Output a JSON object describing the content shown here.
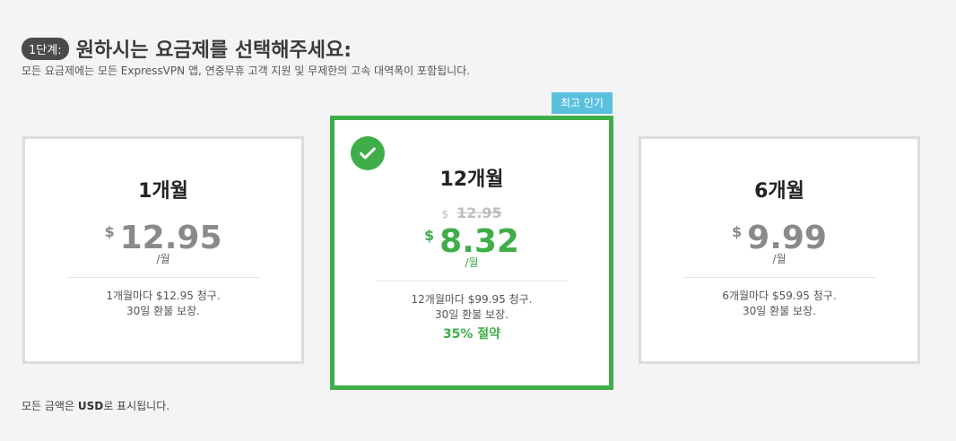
{
  "header": {
    "step_label": "1단계:",
    "title": "원하시는 요금제를 선택해주세요:",
    "subtitle": "모든 요금제에는 모든 ExpressVPN 앱, 연중무휴 고객 지원 및 무제한의 고속 대역폭이 포함됩니다."
  },
  "badge": {
    "label": "최고 인기"
  },
  "plans": {
    "one_month": {
      "name": "1개월",
      "currency": "$",
      "price": "12.95",
      "per": "/월",
      "desc1": "1개월마다 $12.95 청구.",
      "desc2": "30일 환불 보장."
    },
    "twelve_months": {
      "name": "12개월",
      "old_currency": "$",
      "old_price": "12.95",
      "currency": "$",
      "price": "8.32",
      "per": "/월",
      "desc1": "12개월마다 $99.95 청구.",
      "desc2": "30일 환불 보장.",
      "save": "35% 절약"
    },
    "six_months": {
      "name": "6개월",
      "currency": "$",
      "price": "9.99",
      "per": "/월",
      "desc1": "6개월마다 $59.95 청구.",
      "desc2": "30일 환불 보장."
    }
  },
  "footer": {
    "pre": "모든 금액은 ",
    "currency_code": "USD",
    "post": "로 표시됩니다."
  },
  "colors": {
    "accent_green": "#3fae49",
    "badge_blue": "#5bc0de",
    "muted_price": "#8a8a8a"
  }
}
